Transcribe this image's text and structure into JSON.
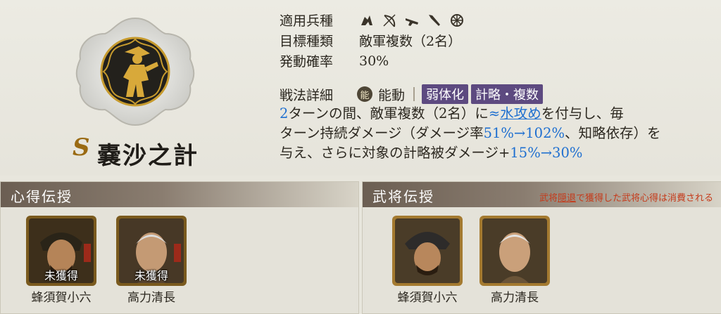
{
  "skill": {
    "rank": "S",
    "name": "嚢沙之計"
  },
  "info": {
    "unit_type_label": "適用兵種",
    "unit_type_icons": [
      "cavalry-icon",
      "bow-icon",
      "gun-icon",
      "spear-icon",
      "cart-wheel-icon"
    ],
    "target_label": "目標種類",
    "target_value": "敵軍複数（2名）",
    "rate_label": "発動確率",
    "rate_value": "30%"
  },
  "detail": {
    "label": "戦法詳細",
    "type_mark": "能",
    "type_label": "能動",
    "tags": [
      "弱体化",
      "計略・複数"
    ]
  },
  "description": {
    "turns": "2",
    "part1": "ターンの間、敵軍複数（2名）に",
    "wave_symbol": "≈",
    "status": "水攻め",
    "part2": "を付与し、毎",
    "part3": "ターン持続ダメージ（ダメージ率",
    "rate_range": "51%→102%",
    "part4": "、知略依存）を",
    "part5": "与え、さらに対象の計略被ダメージ+",
    "bonus_range": "15%→30%"
  },
  "left_panel": {
    "title": "心得伝授",
    "cards": [
      {
        "name": "蜂須賀小六",
        "status": "未獲得"
      },
      {
        "name": "高力清長",
        "status": "未獲得"
      }
    ]
  },
  "right_panel": {
    "title": "武将伝授",
    "note_prefix": "武将",
    "note_link": "隠退",
    "note_suffix": "で獲得した武将心得は消費される",
    "cards": [
      {
        "name": "蜂須賀小六"
      },
      {
        "name": "高力清長"
      }
    ]
  },
  "colors": {
    "accent_blue": "#1e6fd0",
    "tag_purple": "#5d4a80",
    "rank_gold": "#9a6a12",
    "note_red": "#c53a1a"
  }
}
